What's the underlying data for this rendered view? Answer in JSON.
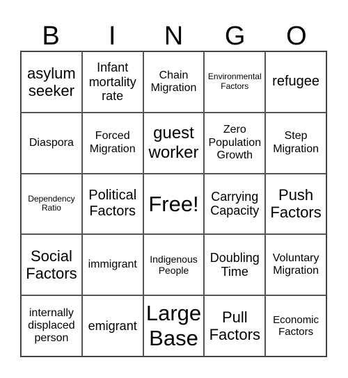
{
  "header": {
    "letters": [
      "B",
      "I",
      "N",
      "G",
      "O"
    ]
  },
  "cells": [
    "asylum seeker",
    "Infant mortality rate",
    "Chain Migration",
    "Environmental Factors",
    "refugee",
    "Diaspora",
    "Forced Migration",
    "guest worker",
    "Zero Population Growth",
    "Step Migration",
    "Dependency Ratio",
    "Political Factors",
    "Free!",
    "Carrying Capacity",
    "Push Factors",
    "Social Factors",
    "immigrant",
    "Indigenous People",
    "Doubling Time",
    "Voluntary Migration",
    "internally displaced person",
    "emigrant",
    "Large Base",
    "Pull Factors",
    "Economic Factors"
  ]
}
